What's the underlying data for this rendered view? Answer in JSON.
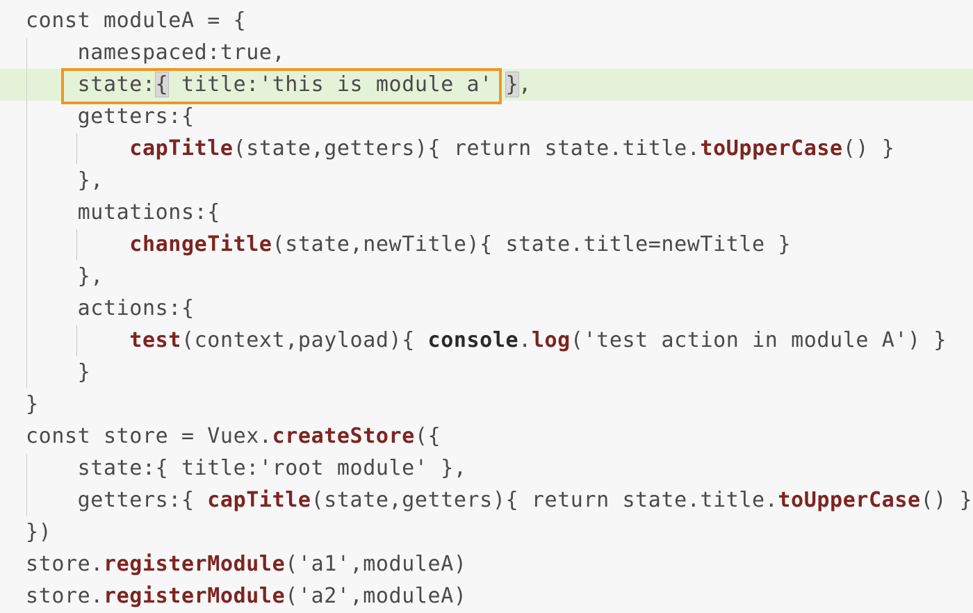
{
  "editor": {
    "highlight_color": "#e4f3d8",
    "selection_border_color": "#f0961e",
    "token_colors": {
      "plain": "#4a4a4a",
      "function": "#7d2421",
      "method": "#2a2a2a"
    },
    "highlighted_line": 3,
    "lines": [
      {
        "tokens": [
          {
            "t": "const moduleA = {",
            "c": "plain"
          }
        ]
      },
      {
        "tokens": [
          {
            "t": "    namespaced:true,",
            "c": "plain"
          }
        ]
      },
      {
        "tokens": [
          {
            "t": "    state:",
            "c": "plain"
          },
          {
            "t": "{",
            "c": "brace-hl"
          },
          {
            "t": " title:'this is module a' ",
            "c": "plain"
          },
          {
            "t": "}",
            "c": "brace-hl"
          },
          {
            "t": ",",
            "c": "plain"
          }
        ]
      },
      {
        "tokens": [
          {
            "t": "    getters:{",
            "c": "plain"
          }
        ]
      },
      {
        "tokens": [
          {
            "t": "        ",
            "c": "plain"
          },
          {
            "t": "capTitle",
            "c": "fn"
          },
          {
            "t": "(state,getters){ return state.title.",
            "c": "plain"
          },
          {
            "t": "toUpperCase",
            "c": "fn"
          },
          {
            "t": "() }",
            "c": "plain"
          }
        ]
      },
      {
        "tokens": [
          {
            "t": "    },",
            "c": "plain"
          }
        ]
      },
      {
        "tokens": [
          {
            "t": "    mutations:{",
            "c": "plain"
          }
        ]
      },
      {
        "tokens": [
          {
            "t": "        ",
            "c": "plain"
          },
          {
            "t": "changeTitle",
            "c": "fn"
          },
          {
            "t": "(state,newTitle){ state.title=newTitle }",
            "c": "plain"
          }
        ]
      },
      {
        "tokens": [
          {
            "t": "    },",
            "c": "plain"
          }
        ]
      },
      {
        "tokens": [
          {
            "t": "    actions:{",
            "c": "plain"
          }
        ]
      },
      {
        "tokens": [
          {
            "t": "        ",
            "c": "plain"
          },
          {
            "t": "test",
            "c": "fn"
          },
          {
            "t": "(context,payload){ ",
            "c": "plain"
          },
          {
            "t": "console",
            "c": "method"
          },
          {
            "t": ".",
            "c": "plain"
          },
          {
            "t": "log",
            "c": "fn"
          },
          {
            "t": "('test action in module A') }",
            "c": "plain"
          }
        ]
      },
      {
        "tokens": [
          {
            "t": "    }",
            "c": "plain"
          }
        ]
      },
      {
        "tokens": [
          {
            "t": "}",
            "c": "plain"
          }
        ]
      },
      {
        "tokens": [
          {
            "t": "const store = Vuex.",
            "c": "plain"
          },
          {
            "t": "createStore",
            "c": "fn"
          },
          {
            "t": "({",
            "c": "plain"
          }
        ]
      },
      {
        "tokens": [
          {
            "t": "    state:{ title:'root module' },",
            "c": "plain"
          }
        ]
      },
      {
        "tokens": [
          {
            "t": "    getters:{ ",
            "c": "plain"
          },
          {
            "t": "capTitle",
            "c": "fn"
          },
          {
            "t": "(state,getters){ return state.title.",
            "c": "plain"
          },
          {
            "t": "toUpperCase",
            "c": "fn"
          },
          {
            "t": "() }}",
            "c": "plain"
          }
        ]
      },
      {
        "tokens": [
          {
            "t": "})",
            "c": "plain"
          }
        ]
      },
      {
        "tokens": [
          {
            "t": "store.",
            "c": "plain"
          },
          {
            "t": "registerModule",
            "c": "fn"
          },
          {
            "t": "('a1',moduleA)",
            "c": "plain"
          }
        ]
      },
      {
        "tokens": [
          {
            "t": "store.",
            "c": "plain"
          },
          {
            "t": "registerModule",
            "c": "fn"
          },
          {
            "t": "('a2',moduleA)",
            "c": "plain"
          }
        ]
      }
    ]
  }
}
